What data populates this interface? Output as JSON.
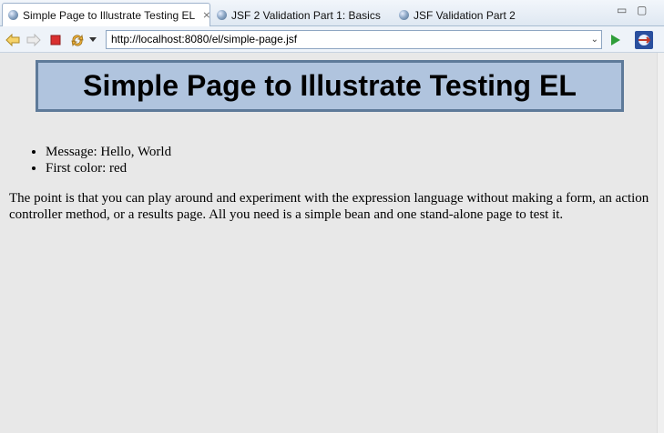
{
  "tabs": [
    {
      "label": "Simple Page to Illustrate Testing EL",
      "active": true,
      "close_glyph": "⨯"
    },
    {
      "label": "JSF 2 Validation Part 1: Basics",
      "active": false
    },
    {
      "label": "JSF Validation Part 2",
      "active": false
    }
  ],
  "window_controls": {
    "minimize": "▭",
    "maximize": "▢"
  },
  "toolbar": {
    "back_icon": "back-arrow-icon",
    "forward_icon": "forward-arrow-icon",
    "stop_icon": "stop-icon",
    "refresh_icon": "refresh-icon",
    "menu_icon": "dropdown-triangle-icon",
    "go_icon": "go-play-icon",
    "eclipse_icon": "eclipse-icon"
  },
  "url": {
    "value": "http://localhost:8080/el/simple-page.jsf",
    "dropdown": "⌄"
  },
  "page": {
    "title": "Simple Page to Illustrate Testing EL",
    "items": [
      "Message: Hello, World",
      "First color: red"
    ],
    "paragraph": "The point is that you can play around and experiment with the expression language without making a form, an action controller method, or a results page. All you need is a simple bean and one stand-alone page to test it."
  },
  "colors": {
    "title_bg": "#b0c4de",
    "title_border": "#5e7a99",
    "page_bg": "#e8e8e8",
    "stop_red": "#d93030",
    "go_green": "#2f9e3a"
  }
}
